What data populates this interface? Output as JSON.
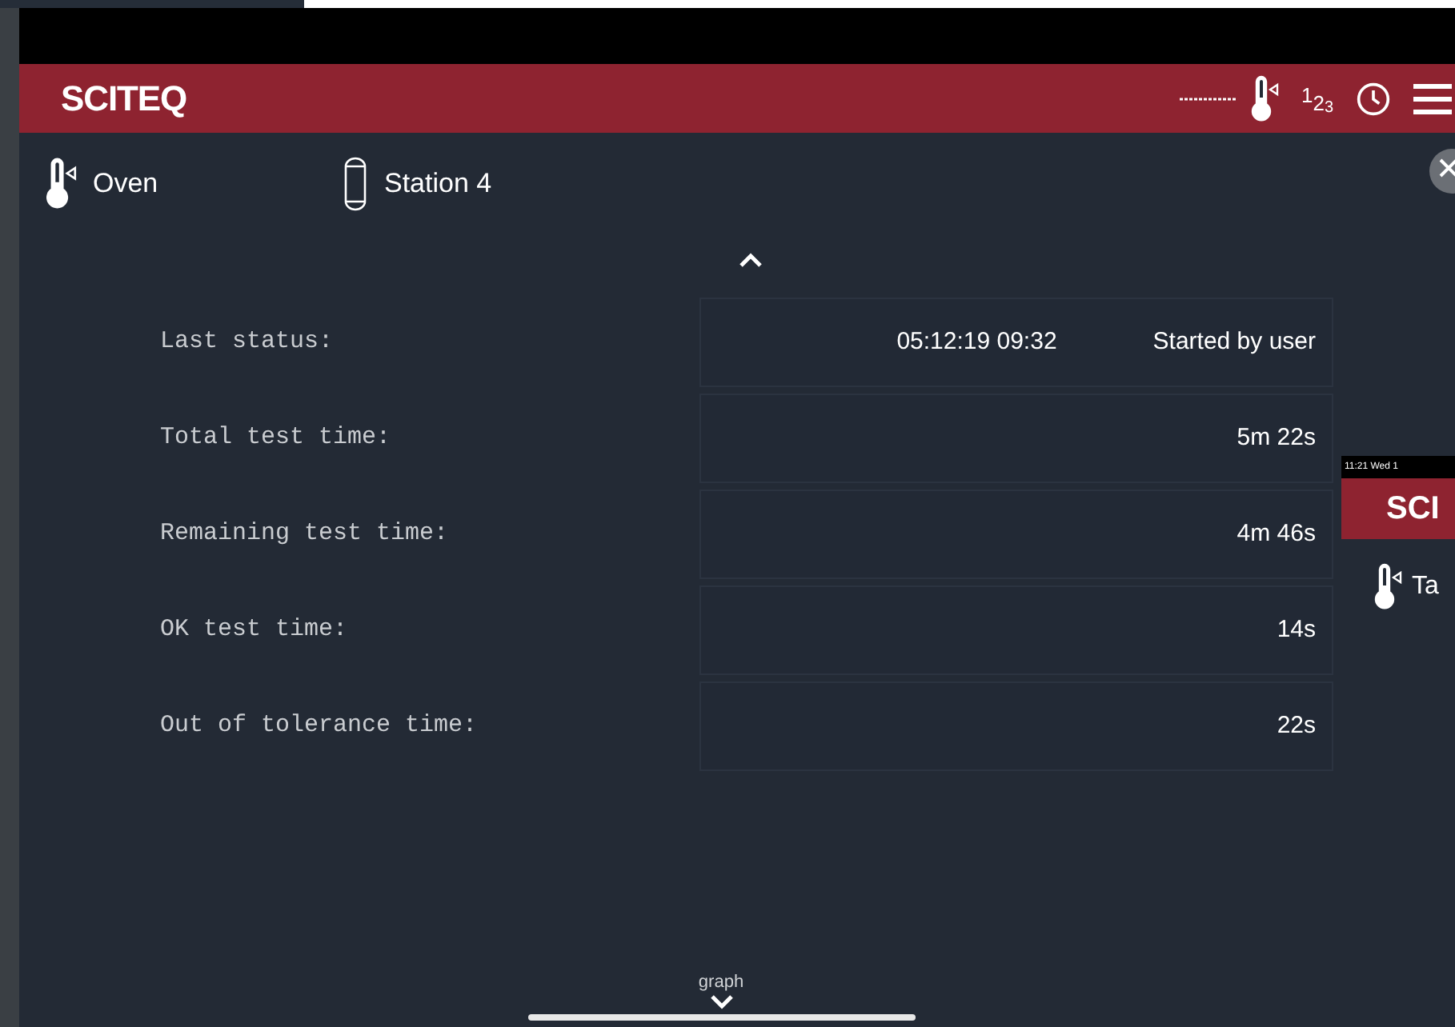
{
  "header": {
    "title": "SCITEQ",
    "number_digits": [
      "1",
      "2",
      "3"
    ]
  },
  "nav": [
    {
      "kind": "oven",
      "label": "Oven"
    },
    {
      "kind": "station",
      "label": "Station 4"
    }
  ],
  "rows": [
    {
      "label": "Last status:",
      "values": [
        "05:12:19 09:32",
        "Started by user"
      ]
    },
    {
      "label": "Total test time:",
      "values": [
        "5m 22s"
      ]
    },
    {
      "label": "Remaining test time:",
      "values": [
        "4m 46s"
      ]
    },
    {
      "label": "OK test time:",
      "values": [
        "14s"
      ]
    },
    {
      "label": "Out of tolerance time:",
      "values": [
        "22s"
      ]
    }
  ],
  "footer": {
    "label": "graph"
  },
  "background_window": {
    "status": "11:21  Wed 1",
    "title": "SCI",
    "item": "Ta"
  }
}
